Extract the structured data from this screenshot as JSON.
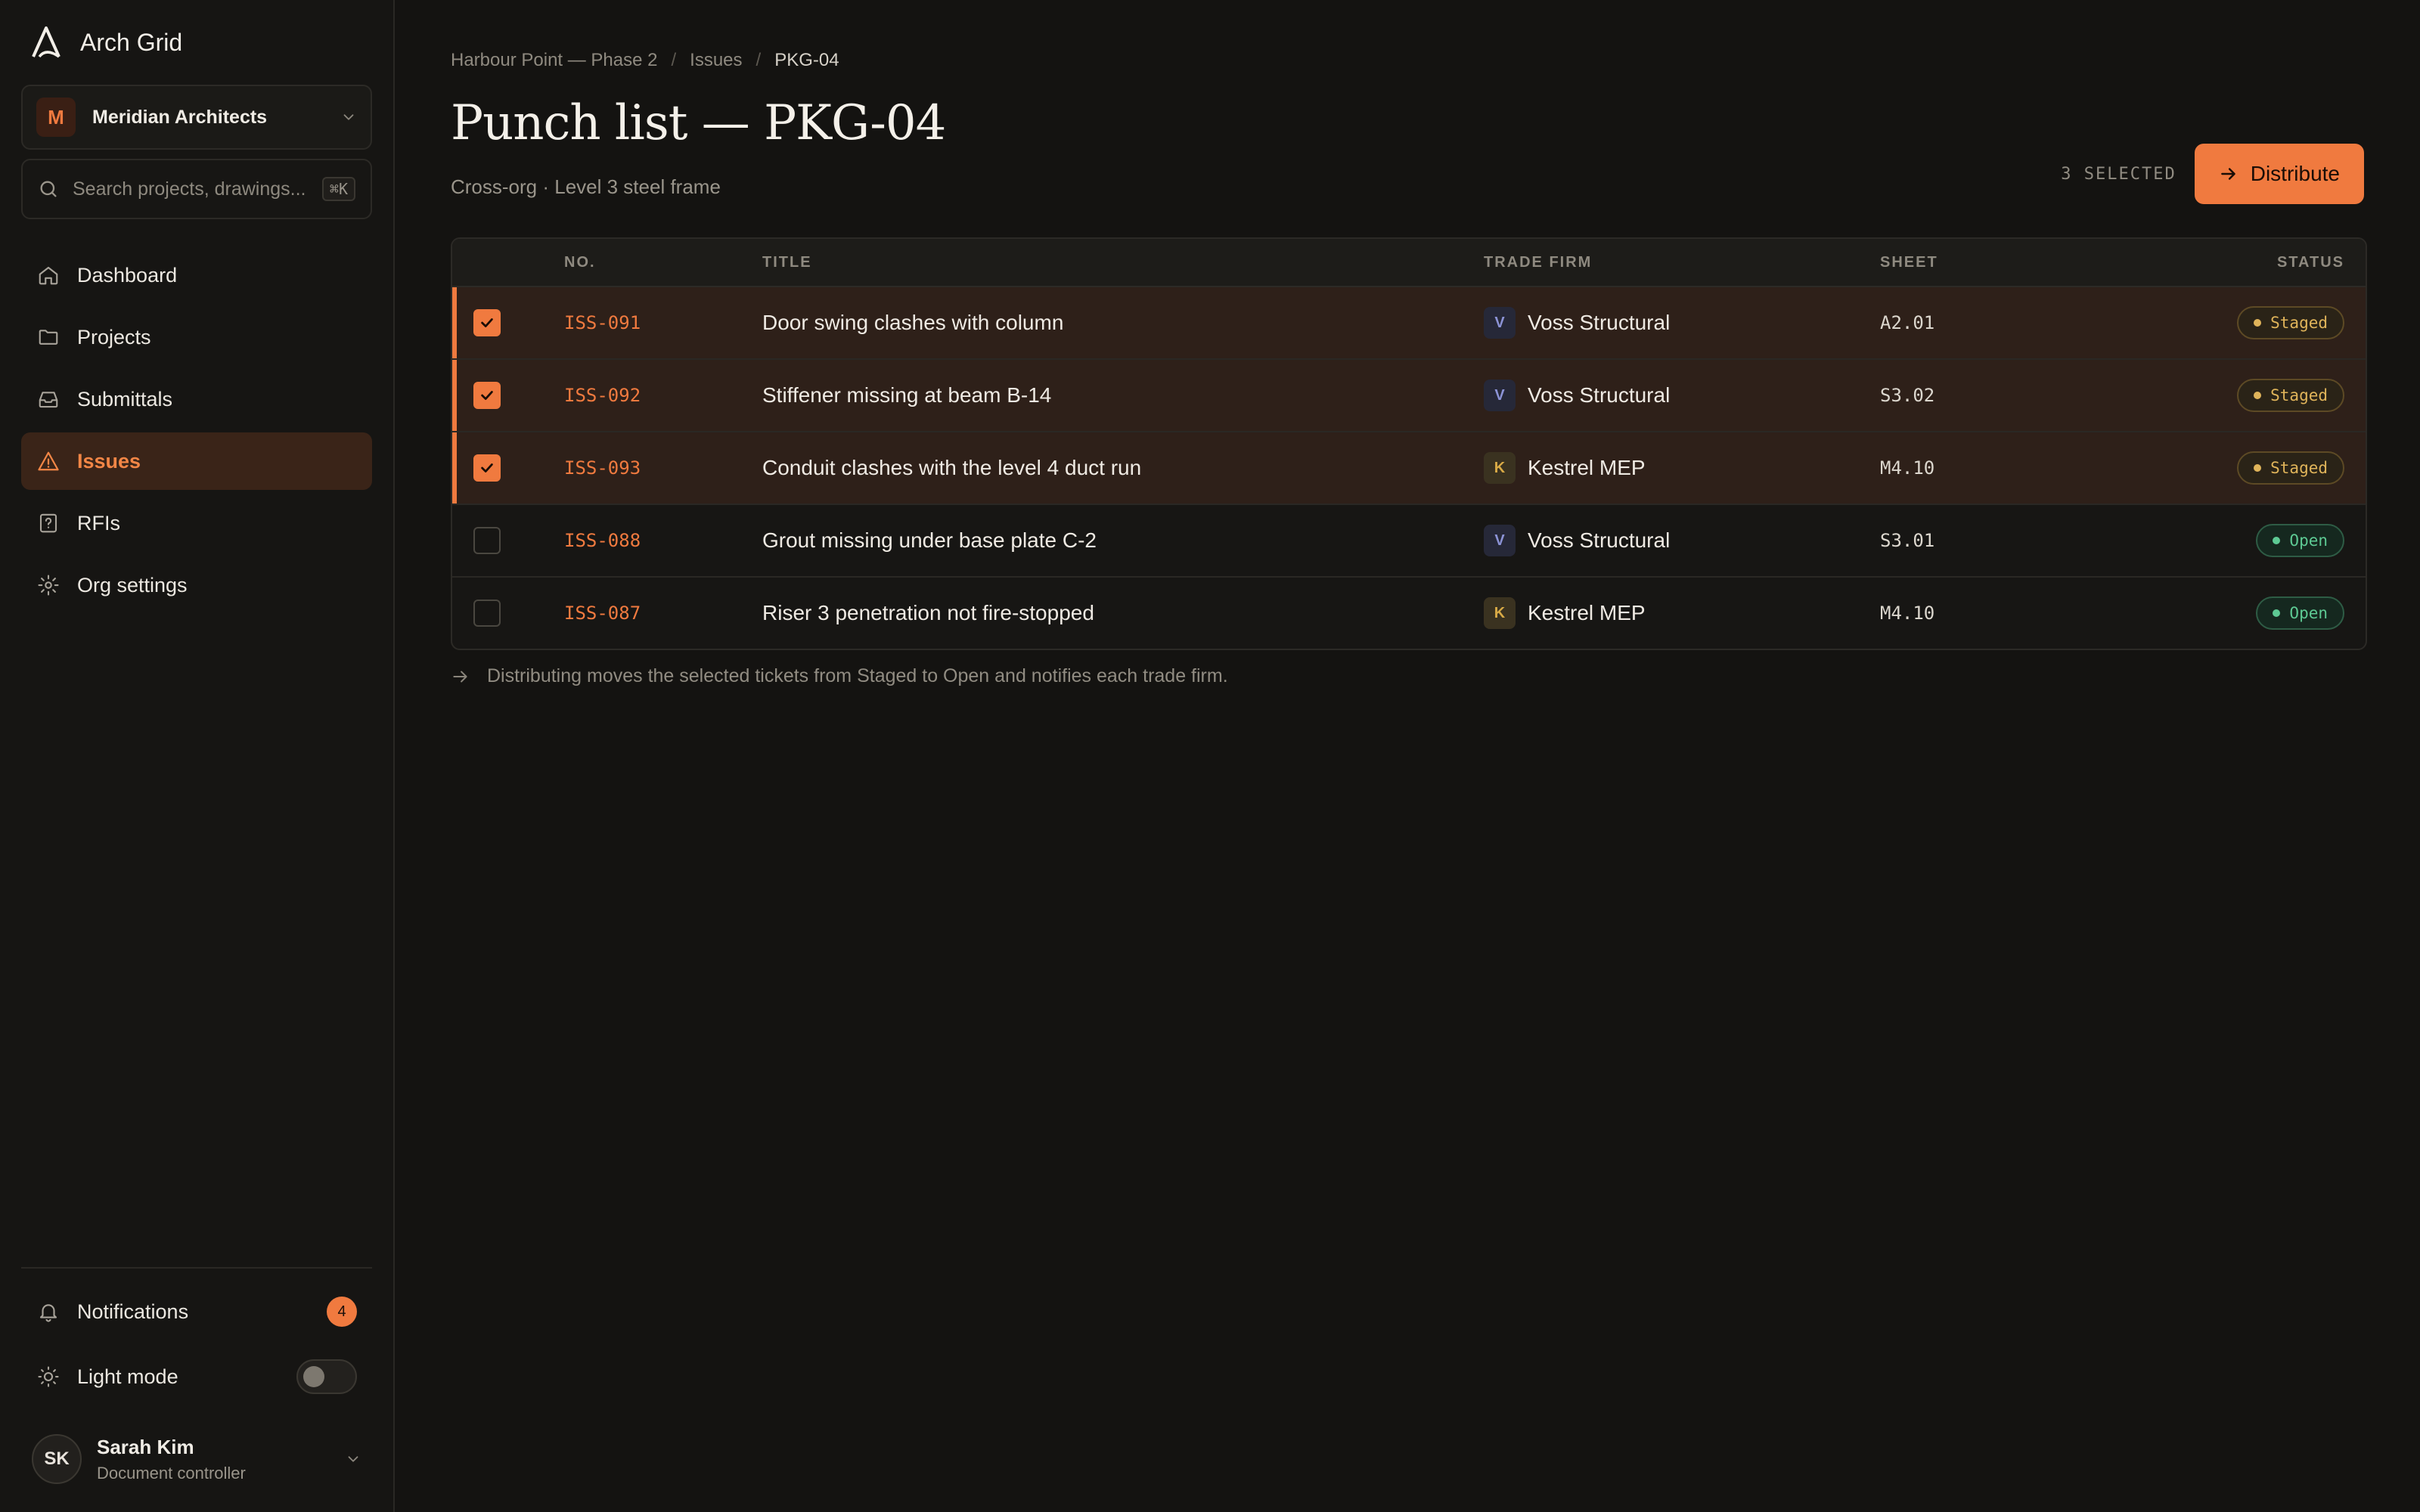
{
  "app": {
    "name": "Arch Grid"
  },
  "org": {
    "initial": "M",
    "name": "Meridian Architects"
  },
  "search": {
    "placeholder": "Search projects, drawings...",
    "shortcut": "⌘K"
  },
  "nav": [
    {
      "label": "Dashboard",
      "icon": "home-icon",
      "active": false
    },
    {
      "label": "Projects",
      "icon": "folder-icon",
      "active": false
    },
    {
      "label": "Submittals",
      "icon": "inbox-icon",
      "active": false
    },
    {
      "label": "Issues",
      "icon": "warning-icon",
      "active": true
    },
    {
      "label": "RFIs",
      "icon": "question-icon",
      "active": false
    },
    {
      "label": "Org settings",
      "icon": "gear-icon",
      "active": false
    }
  ],
  "bottom": {
    "notifications_label": "Notifications",
    "notifications_count": "4",
    "light_mode_label": "Light mode",
    "light_mode_on": false
  },
  "user": {
    "initials": "SK",
    "name": "Sarah Kim",
    "role": "Document controller"
  },
  "breadcrumb": [
    "Harbour Point — Phase 2",
    "Issues",
    "PKG-04"
  ],
  "page": {
    "title": "Punch list — PKG-04",
    "subtitle": "Cross-org · Level 3 steel frame",
    "selected_count": "3 SELECTED",
    "distribute_label": "Distribute"
  },
  "table": {
    "headers": {
      "no": "NO.",
      "title": "TITLE",
      "firm": "TRADE FIRM",
      "sheet": "SHEET",
      "status": "STATUS"
    },
    "rows": [
      {
        "no": "ISS-091",
        "title": "Door swing clashes with column",
        "firm_initial": "V",
        "firm": "Voss Structural",
        "sheet": "A2.01",
        "status": "Staged",
        "selected": true
      },
      {
        "no": "ISS-092",
        "title": "Stiffener missing at beam B-14",
        "firm_initial": "V",
        "firm": "Voss Structural",
        "sheet": "S3.02",
        "status": "Staged",
        "selected": true
      },
      {
        "no": "ISS-093",
        "title": "Conduit clashes with the level 4 duct run",
        "firm_initial": "K",
        "firm": "Kestrel MEP",
        "sheet": "M4.10",
        "status": "Staged",
        "selected": true
      },
      {
        "no": "ISS-088",
        "title": "Grout missing under base plate C-2",
        "firm_initial": "V",
        "firm": "Voss Structural",
        "sheet": "S3.01",
        "status": "Open",
        "selected": false
      },
      {
        "no": "ISS-087",
        "title": "Riser 3 penetration not fire-stopped",
        "firm_initial": "K",
        "firm": "Kestrel MEP",
        "sheet": "M4.10",
        "status": "Open",
        "selected": false
      }
    ]
  },
  "footnote": "Distributing moves the selected tickets from Staged to Open and notifies each trade firm.",
  "colors": {
    "accent": "#f07a3f",
    "staged": "#e0b45a",
    "open": "#5dc993",
    "background": "#141311"
  }
}
